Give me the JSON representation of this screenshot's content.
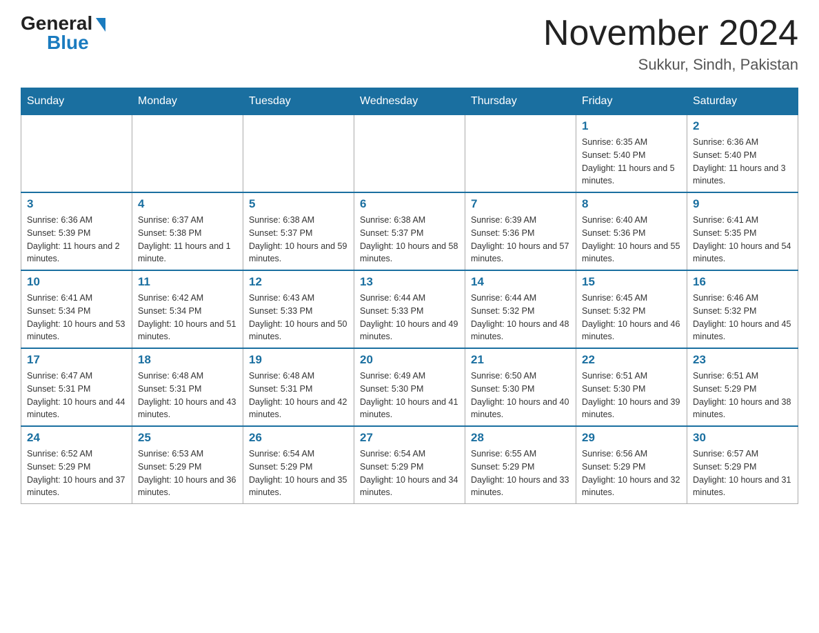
{
  "header": {
    "logo_general": "General",
    "logo_blue": "Blue",
    "month_title": "November 2024",
    "location": "Sukkur, Sindh, Pakistan"
  },
  "weekdays": [
    "Sunday",
    "Monday",
    "Tuesday",
    "Wednesday",
    "Thursday",
    "Friday",
    "Saturday"
  ],
  "weeks": [
    [
      {
        "day": "",
        "info": ""
      },
      {
        "day": "",
        "info": ""
      },
      {
        "day": "",
        "info": ""
      },
      {
        "day": "",
        "info": ""
      },
      {
        "day": "",
        "info": ""
      },
      {
        "day": "1",
        "info": "Sunrise: 6:35 AM\nSunset: 5:40 PM\nDaylight: 11 hours and 5 minutes."
      },
      {
        "day": "2",
        "info": "Sunrise: 6:36 AM\nSunset: 5:40 PM\nDaylight: 11 hours and 3 minutes."
      }
    ],
    [
      {
        "day": "3",
        "info": "Sunrise: 6:36 AM\nSunset: 5:39 PM\nDaylight: 11 hours and 2 minutes."
      },
      {
        "day": "4",
        "info": "Sunrise: 6:37 AM\nSunset: 5:38 PM\nDaylight: 11 hours and 1 minute."
      },
      {
        "day": "5",
        "info": "Sunrise: 6:38 AM\nSunset: 5:37 PM\nDaylight: 10 hours and 59 minutes."
      },
      {
        "day": "6",
        "info": "Sunrise: 6:38 AM\nSunset: 5:37 PM\nDaylight: 10 hours and 58 minutes."
      },
      {
        "day": "7",
        "info": "Sunrise: 6:39 AM\nSunset: 5:36 PM\nDaylight: 10 hours and 57 minutes."
      },
      {
        "day": "8",
        "info": "Sunrise: 6:40 AM\nSunset: 5:36 PM\nDaylight: 10 hours and 55 minutes."
      },
      {
        "day": "9",
        "info": "Sunrise: 6:41 AM\nSunset: 5:35 PM\nDaylight: 10 hours and 54 minutes."
      }
    ],
    [
      {
        "day": "10",
        "info": "Sunrise: 6:41 AM\nSunset: 5:34 PM\nDaylight: 10 hours and 53 minutes."
      },
      {
        "day": "11",
        "info": "Sunrise: 6:42 AM\nSunset: 5:34 PM\nDaylight: 10 hours and 51 minutes."
      },
      {
        "day": "12",
        "info": "Sunrise: 6:43 AM\nSunset: 5:33 PM\nDaylight: 10 hours and 50 minutes."
      },
      {
        "day": "13",
        "info": "Sunrise: 6:44 AM\nSunset: 5:33 PM\nDaylight: 10 hours and 49 minutes."
      },
      {
        "day": "14",
        "info": "Sunrise: 6:44 AM\nSunset: 5:32 PM\nDaylight: 10 hours and 48 minutes."
      },
      {
        "day": "15",
        "info": "Sunrise: 6:45 AM\nSunset: 5:32 PM\nDaylight: 10 hours and 46 minutes."
      },
      {
        "day": "16",
        "info": "Sunrise: 6:46 AM\nSunset: 5:32 PM\nDaylight: 10 hours and 45 minutes."
      }
    ],
    [
      {
        "day": "17",
        "info": "Sunrise: 6:47 AM\nSunset: 5:31 PM\nDaylight: 10 hours and 44 minutes."
      },
      {
        "day": "18",
        "info": "Sunrise: 6:48 AM\nSunset: 5:31 PM\nDaylight: 10 hours and 43 minutes."
      },
      {
        "day": "19",
        "info": "Sunrise: 6:48 AM\nSunset: 5:31 PM\nDaylight: 10 hours and 42 minutes."
      },
      {
        "day": "20",
        "info": "Sunrise: 6:49 AM\nSunset: 5:30 PM\nDaylight: 10 hours and 41 minutes."
      },
      {
        "day": "21",
        "info": "Sunrise: 6:50 AM\nSunset: 5:30 PM\nDaylight: 10 hours and 40 minutes."
      },
      {
        "day": "22",
        "info": "Sunrise: 6:51 AM\nSunset: 5:30 PM\nDaylight: 10 hours and 39 minutes."
      },
      {
        "day": "23",
        "info": "Sunrise: 6:51 AM\nSunset: 5:29 PM\nDaylight: 10 hours and 38 minutes."
      }
    ],
    [
      {
        "day": "24",
        "info": "Sunrise: 6:52 AM\nSunset: 5:29 PM\nDaylight: 10 hours and 37 minutes."
      },
      {
        "day": "25",
        "info": "Sunrise: 6:53 AM\nSunset: 5:29 PM\nDaylight: 10 hours and 36 minutes."
      },
      {
        "day": "26",
        "info": "Sunrise: 6:54 AM\nSunset: 5:29 PM\nDaylight: 10 hours and 35 minutes."
      },
      {
        "day": "27",
        "info": "Sunrise: 6:54 AM\nSunset: 5:29 PM\nDaylight: 10 hours and 34 minutes."
      },
      {
        "day": "28",
        "info": "Sunrise: 6:55 AM\nSunset: 5:29 PM\nDaylight: 10 hours and 33 minutes."
      },
      {
        "day": "29",
        "info": "Sunrise: 6:56 AM\nSunset: 5:29 PM\nDaylight: 10 hours and 32 minutes."
      },
      {
        "day": "30",
        "info": "Sunrise: 6:57 AM\nSunset: 5:29 PM\nDaylight: 10 hours and 31 minutes."
      }
    ]
  ]
}
